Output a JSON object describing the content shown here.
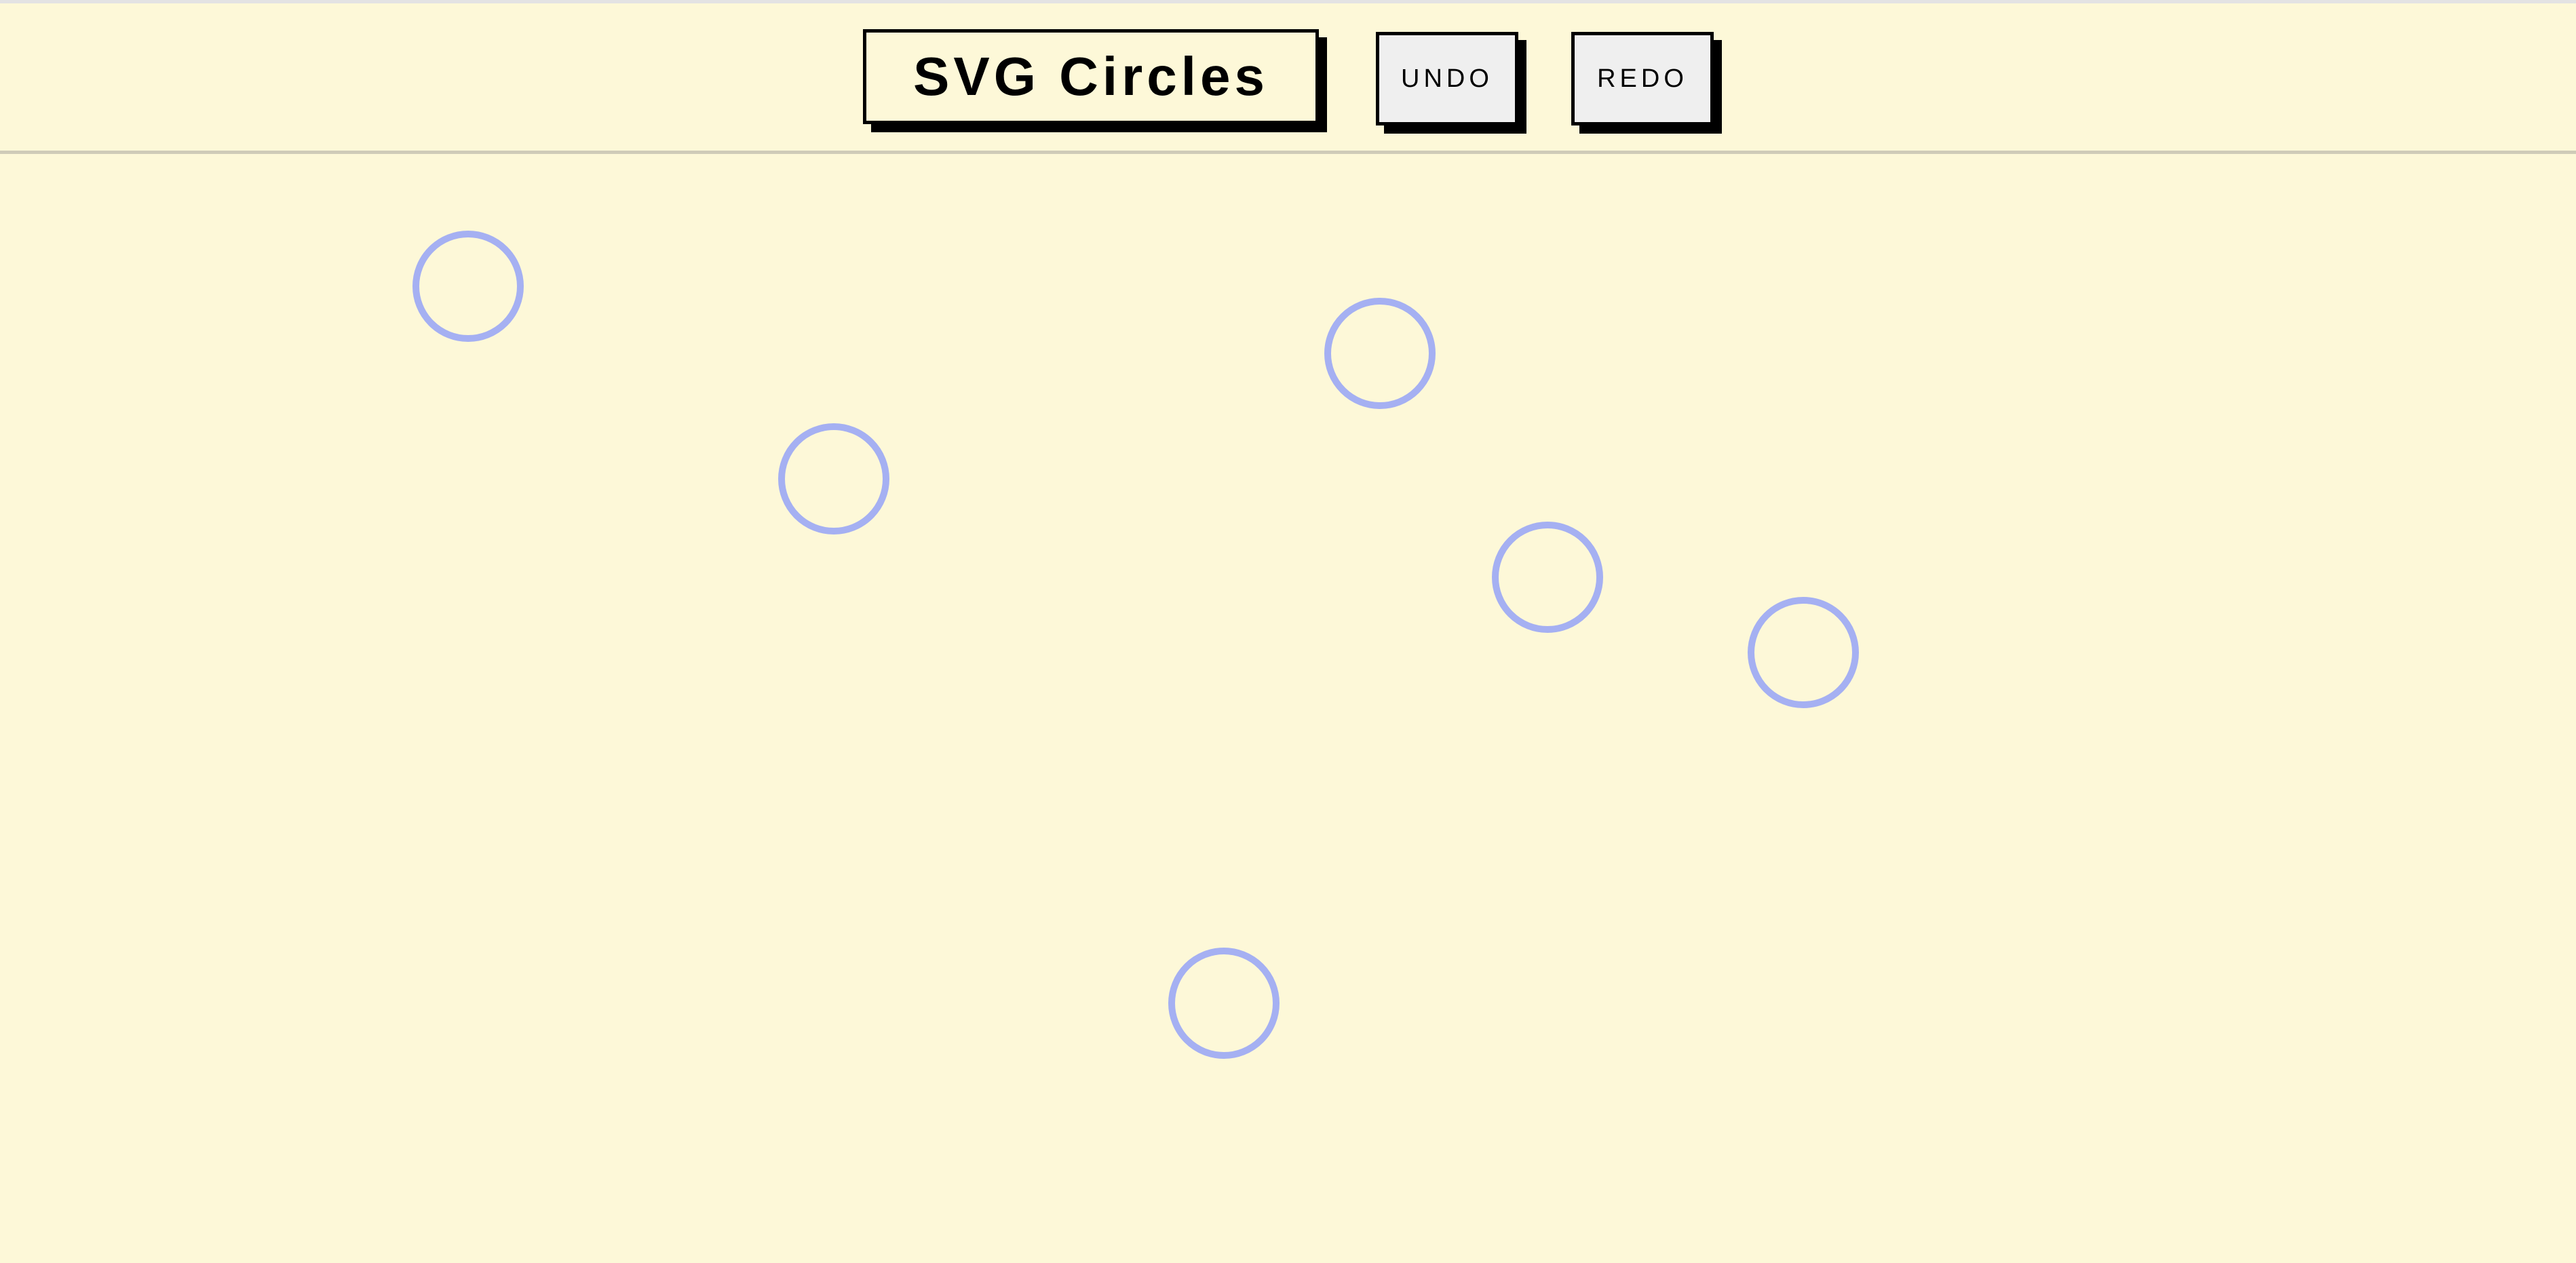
{
  "app": {
    "title": "SVG Circles",
    "background_color": "#fdf8d8"
  },
  "toolbar": {
    "undo_label": "UNDO",
    "redo_label": "REDO"
  },
  "canvas": {
    "circle_stroke_color": "#a5b0f2",
    "circle_count": 6
  }
}
